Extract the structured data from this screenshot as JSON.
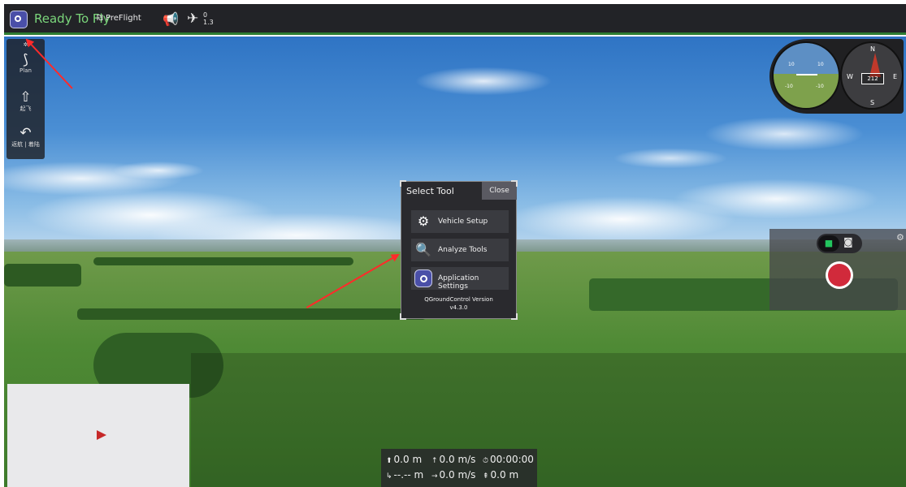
{
  "topbar": {
    "status": "Ready To Fly",
    "flight_mode": "PreFlight",
    "gps_count": "0",
    "gps_hdop": "1.3"
  },
  "toolstrip": {
    "items": [
      {
        "label": "",
        "icon": "gear-icon"
      },
      {
        "label": "Plan",
        "icon": "plan-path-icon"
      },
      {
        "label": "起飞",
        "icon": "takeoff-icon"
      },
      {
        "label": "返航 | 着陆",
        "icon": "return-icon"
      }
    ]
  },
  "dialog": {
    "title": "Select Tool",
    "close_label": "Close",
    "buttons": [
      {
        "label": "Vehicle Setup",
        "icon": "gears-icon"
      },
      {
        "label": "Analyze Tools",
        "icon": "analyze-icon"
      },
      {
        "label": "Application Settings",
        "icon": "qgc-logo-icon"
      }
    ],
    "version_line1": "QGroundControl Version",
    "version_line2": "v4.3.0"
  },
  "instruments": {
    "pitch_up": "10",
    "pitch_down": "-10",
    "heading": "212",
    "compass_n": "N",
    "compass_e": "E",
    "compass_s": "S",
    "compass_w": "W"
  },
  "telemetry": {
    "altitude": "0.0 m",
    "vertical_speed": "0.0 m/s",
    "flight_time": "00:00:00",
    "distance": "--.-- m",
    "horizontal_speed": "0.0 m/s",
    "distance_home": "0.0 m"
  },
  "colors": {
    "ready_green": "#7bd67b",
    "record_red": "#d12a3b",
    "annotation_red": "#ff2a2a"
  }
}
